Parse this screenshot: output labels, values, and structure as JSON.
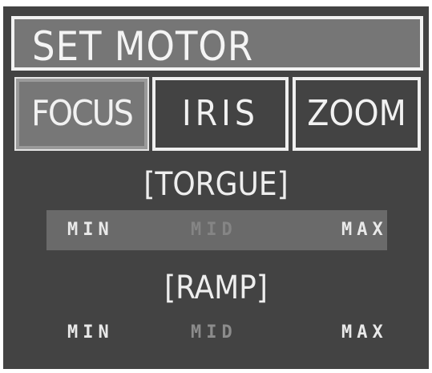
{
  "title": "SET MOTOR",
  "tabs": [
    {
      "label": "FOCUS",
      "selected": true
    },
    {
      "label": "IRIS",
      "selected": false
    },
    {
      "label": "ZOOM",
      "selected": false
    }
  ],
  "torque": {
    "heading": "[TORGUE]",
    "min_label": "MIN",
    "mid_label": "MID",
    "max_label": "MAX",
    "selected": "MID"
  },
  "ramp": {
    "heading": "[RAMP]",
    "min_label": "MIN",
    "mid_label": "MID",
    "max_label": "MAX",
    "selected": "MID"
  },
  "colors": {
    "background": "#434343",
    "highlight": "#767676",
    "text": "#ececec",
    "dim_text": "#8c8c8c"
  }
}
